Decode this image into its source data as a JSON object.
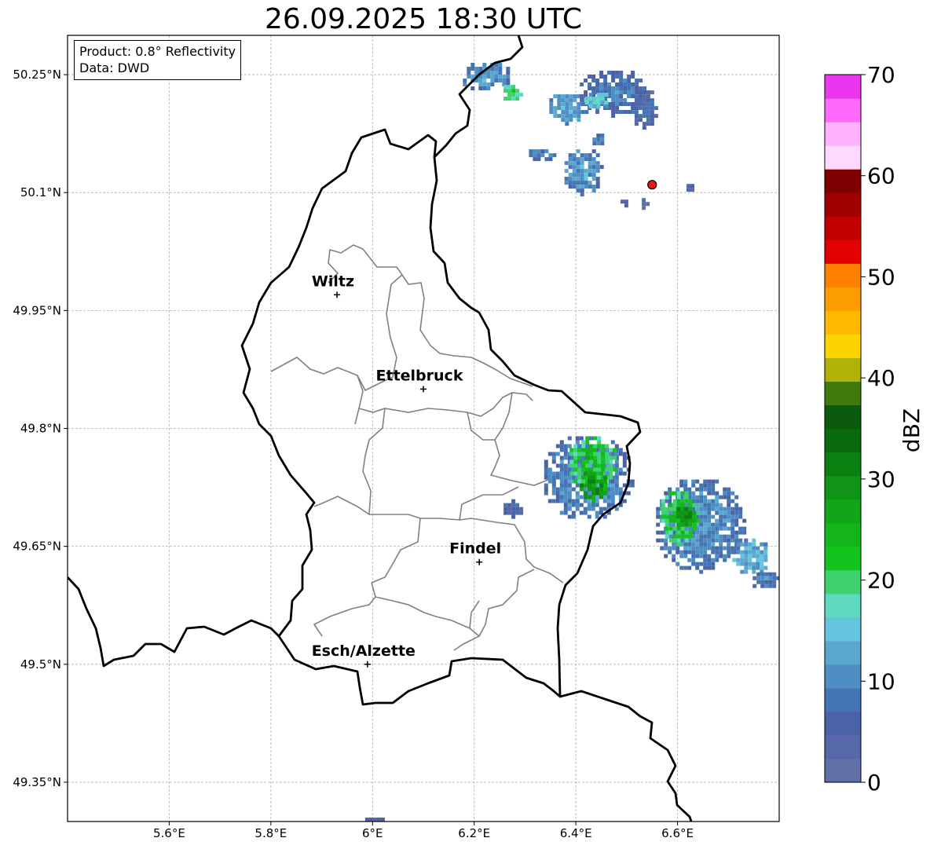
{
  "title": "26.09.2025 18:30 UTC",
  "info_box": {
    "product": "Product: 0.8° Reflectivity",
    "data_source": "Data: DWD"
  },
  "map": {
    "lon_range": [
      5.4,
      6.8
    ],
    "lat_range": [
      49.3,
      50.3
    ],
    "lon_ticks": [
      {
        "value": 5.6,
        "label": "5.6°E"
      },
      {
        "value": 5.8,
        "label": "5.8°E"
      },
      {
        "value": 6.0,
        "label": "6°E"
      },
      {
        "value": 6.2,
        "label": "6.2°E"
      },
      {
        "value": 6.4,
        "label": "6.4°E"
      },
      {
        "value": 6.6,
        "label": "6.6°E"
      }
    ],
    "lat_ticks": [
      {
        "value": 50.25,
        "label": "50.25°N"
      },
      {
        "value": 50.1,
        "label": "50.1°N"
      },
      {
        "value": 49.95,
        "label": "49.95°N"
      },
      {
        "value": 49.8,
        "label": "49.8°N"
      },
      {
        "value": 49.65,
        "label": "49.65°N"
      },
      {
        "value": 49.5,
        "label": "49.5°N"
      },
      {
        "value": 49.35,
        "label": "49.35°N"
      }
    ],
    "cities": [
      {
        "name": "Wiltz",
        "lon": 5.93,
        "lat": 49.97
      },
      {
        "name": "Ettelbruck",
        "lon": 6.1,
        "lat": 49.85
      },
      {
        "name": "Findel",
        "lon": 6.21,
        "lat": 49.63
      },
      {
        "name": "Esch/Alzette",
        "lon": 5.99,
        "lat": 49.5
      }
    ],
    "radar_site": {
      "lon": 6.55,
      "lat": 50.11,
      "color": "#e31a1c"
    },
    "echoes": [
      {
        "lon": 6.22,
        "lat": 50.25,
        "r_lon": 0.05,
        "r_lat": 0.02,
        "dbz": 12
      },
      {
        "lon": 6.27,
        "lat": 50.23,
        "r_lon": 0.02,
        "r_lat": 0.012,
        "dbz": 22
      },
      {
        "lon": 6.38,
        "lat": 50.21,
        "r_lon": 0.04,
        "r_lat": 0.02,
        "dbz": 13
      },
      {
        "lon": 6.47,
        "lat": 50.23,
        "r_lon": 0.07,
        "r_lat": 0.03,
        "dbz": 9
      },
      {
        "lon": 6.44,
        "lat": 50.22,
        "r_lon": 0.03,
        "r_lat": 0.012,
        "dbz": 16
      },
      {
        "lon": 6.53,
        "lat": 50.21,
        "r_lon": 0.03,
        "r_lat": 0.025,
        "dbz": 7
      },
      {
        "lon": 6.41,
        "lat": 50.13,
        "r_lon": 0.04,
        "r_lat": 0.03,
        "dbz": 12
      },
      {
        "lon": 6.33,
        "lat": 50.15,
        "r_lon": 0.03,
        "r_lat": 0.01,
        "dbz": 10
      },
      {
        "lon": 6.44,
        "lat": 50.17,
        "r_lon": 0.015,
        "r_lat": 0.01,
        "dbz": 8
      },
      {
        "lon": 6.62,
        "lat": 50.11,
        "r_lon": 0.01,
        "r_lat": 0.006,
        "dbz": 6
      },
      {
        "lon": 6.49,
        "lat": 50.09,
        "r_lon": 0.01,
        "r_lat": 0.006,
        "dbz": 6
      },
      {
        "lon": 6.53,
        "lat": 50.09,
        "r_lon": 0.008,
        "r_lat": 0.008,
        "dbz": 6
      },
      {
        "lon": 6.42,
        "lat": 49.74,
        "r_lon": 0.09,
        "r_lat": 0.055,
        "dbz": 11
      },
      {
        "lon": 6.43,
        "lat": 49.76,
        "r_lon": 0.05,
        "r_lat": 0.035,
        "dbz": 23
      },
      {
        "lon": 6.43,
        "lat": 49.73,
        "r_lon": 0.03,
        "r_lat": 0.02,
        "dbz": 30
      },
      {
        "lon": 6.27,
        "lat": 49.7,
        "r_lon": 0.02,
        "r_lat": 0.015,
        "dbz": 7
      },
      {
        "lon": 6.64,
        "lat": 49.68,
        "r_lon": 0.09,
        "r_lat": 0.06,
        "dbz": 11
      },
      {
        "lon": 6.6,
        "lat": 49.69,
        "r_lon": 0.04,
        "r_lat": 0.035,
        "dbz": 23
      },
      {
        "lon": 6.61,
        "lat": 49.69,
        "r_lon": 0.02,
        "r_lat": 0.015,
        "dbz": 31
      },
      {
        "lon": 6.74,
        "lat": 49.64,
        "r_lon": 0.04,
        "r_lat": 0.025,
        "dbz": 14
      },
      {
        "lon": 6.77,
        "lat": 49.61,
        "r_lon": 0.03,
        "r_lat": 0.012,
        "dbz": 9
      },
      {
        "lon": 6.0,
        "lat": 49.3,
        "r_lon": 0.03,
        "r_lat": 0.01,
        "dbz": 6
      }
    ]
  },
  "colorbar": {
    "label": "dBZ",
    "min": 0,
    "max": 70,
    "ticks": [
      0,
      10,
      20,
      30,
      40,
      50,
      60,
      70
    ],
    "colors": [
      "#6170a8",
      "#5768a8",
      "#4a62a6",
      "#4474b3",
      "#4f8ec2",
      "#5ba8cf",
      "#66c5de",
      "#5fd9c0",
      "#3fd36f",
      "#14c41e",
      "#14b41b",
      "#11a517",
      "#0f9416",
      "#0c7f11",
      "#0a6a0e",
      "#0b590d",
      "#3f7a0b",
      "#b1b208",
      "#fed400",
      "#fdb800",
      "#fe9d00",
      "#ff7f00",
      "#e30000",
      "#c20000",
      "#a10000",
      "#7e0000",
      "#fed9ff",
      "#feb2fd",
      "#fe6bfb",
      "#ec35ef"
    ]
  }
}
